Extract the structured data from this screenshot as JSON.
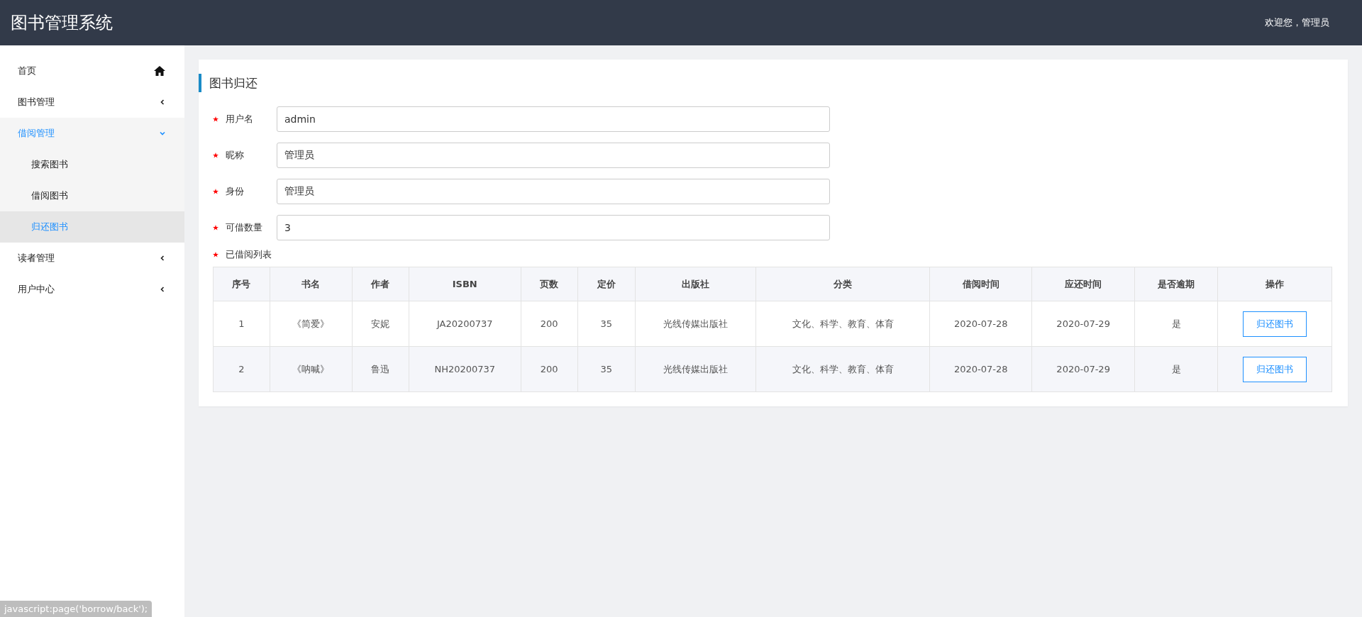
{
  "header": {
    "title": "图书管理系统",
    "welcome": "欢迎您，管理员"
  },
  "sidebar": {
    "items": [
      {
        "label": "首页",
        "kind": "home",
        "selected": false
      },
      {
        "label": "图书管理",
        "kind": "group",
        "expanded": false,
        "selected": false
      },
      {
        "label": "借阅管理",
        "kind": "group",
        "expanded": true,
        "selected": true,
        "children": [
          {
            "label": "搜索图书",
            "selected": false
          },
          {
            "label": "借阅图书",
            "selected": false
          },
          {
            "label": "归还图书",
            "selected": true
          }
        ]
      },
      {
        "label": "读者管理",
        "kind": "group",
        "expanded": false,
        "selected": false
      },
      {
        "label": "用户中心",
        "kind": "group",
        "expanded": false,
        "selected": false
      }
    ]
  },
  "panel": {
    "title": "图书归还",
    "fields": [
      {
        "label": "用户名",
        "value": "admin",
        "required": true
      },
      {
        "label": "昵称",
        "value": "管理员",
        "required": true
      },
      {
        "label": "身份",
        "value": "管理员",
        "required": true
      },
      {
        "label": "可借数量",
        "value": "3",
        "required": true
      }
    ],
    "list_label": {
      "label": "已借阅列表",
      "required": true
    },
    "table": {
      "columns": [
        "序号",
        "书名",
        "作者",
        "ISBN",
        "页数",
        "定价",
        "出版社",
        "分类",
        "借阅时间",
        "应还时间",
        "是否逾期",
        "操作"
      ],
      "rows": [
        {
          "cells": [
            "1",
            "《简爱》",
            "安妮",
            "JA20200737",
            "200",
            "35",
            "光线传媒出版社",
            "文化、科学、教育、体育",
            "2020-07-28",
            "2020-07-29",
            "是"
          ],
          "action": "归还图书"
        },
        {
          "cells": [
            "2",
            "《呐喊》",
            "鲁迅",
            "NH20200737",
            "200",
            "35",
            "光线传媒出版社",
            "文化、科学、教育、体育",
            "2020-07-28",
            "2020-07-29",
            "是"
          ],
          "action": "归还图书"
        }
      ]
    }
  },
  "status_bar": "javascript:page('borrow/back');"
}
